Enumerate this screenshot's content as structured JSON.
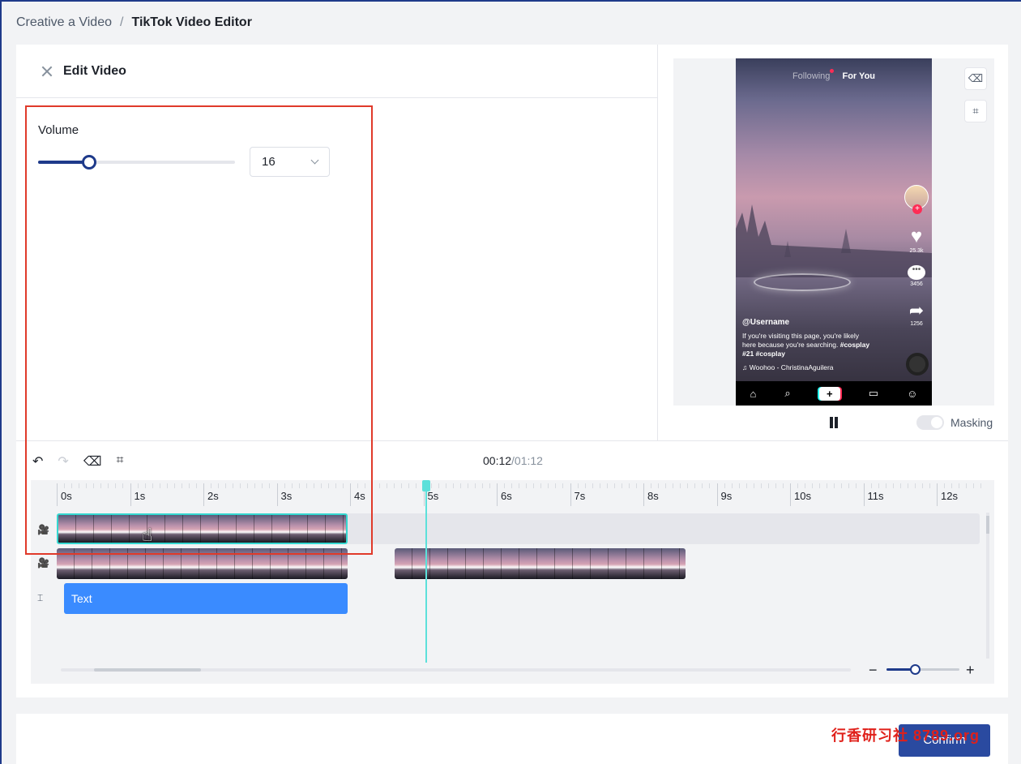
{
  "breadcrumb": {
    "parent": "Creative a Video",
    "separator": "/",
    "current": "TikTok Video Editor"
  },
  "panel": {
    "title": "Edit Video"
  },
  "volume": {
    "label": "Volume",
    "value": "16",
    "slider_fraction": 0.26
  },
  "preview": {
    "tabs": {
      "following": "Following",
      "for_you": "For You"
    },
    "likes": "25.3k",
    "comments": "3456",
    "shares": "1256",
    "username": "@Username",
    "caption_lines": [
      "If you're visiting this page, you're likely",
      "here because you're searching.",
      "#cosplay",
      "#21 #cosplay"
    ],
    "music": "Woohoo - ChristinaAguilera",
    "icons": [
      "home-icon",
      "search-icon",
      "add-icon",
      "inbox-icon",
      "profile-icon"
    ]
  },
  "masking": {
    "label": "Masking",
    "enabled": false
  },
  "timecode": {
    "current": "00:12",
    "total": "/01:12"
  },
  "ruler": {
    "labels": [
      "0s",
      "1s",
      "2s",
      "3s",
      "4s",
      "5s",
      "6s",
      "7s",
      "8s",
      "9s",
      "10s",
      "11s",
      "12s"
    ]
  },
  "tracks": {
    "text_clip_label": "Text"
  },
  "zoom": {
    "minus": "−",
    "plus": "+",
    "fraction": 0.39
  },
  "footer": {
    "confirm": "Confirm",
    "watermark": "行香研习社 8789.org"
  },
  "colors": {
    "accent": "#1e3a8a",
    "playhead": "#5ce0da",
    "text_clip": "#3a8bff",
    "highlight": "#e03a2a"
  }
}
